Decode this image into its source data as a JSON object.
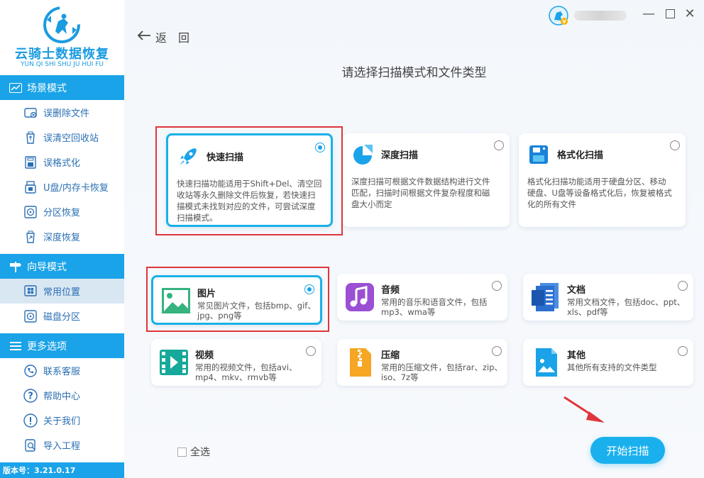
{
  "app": {
    "logo_title": "云骑士数据恢复",
    "logo_subtitle": "YUN QI SHI SHU JU HUI FU",
    "version": "版本号：3.21.0.17"
  },
  "sidebar": {
    "sections": [
      {
        "label": "场景模式",
        "icon": "chart-icon",
        "items": [
          {
            "label": "误删除文件",
            "icon": "disk-delete-icon"
          },
          {
            "label": "误清空回收站",
            "icon": "recycle-bin-icon"
          },
          {
            "label": "误格式化",
            "icon": "format-icon"
          },
          {
            "label": "U盘/内存卡恢复",
            "icon": "usb-icon"
          },
          {
            "label": "分区恢复",
            "icon": "partition-icon"
          },
          {
            "label": "深度恢复",
            "icon": "deep-recover-icon"
          }
        ]
      },
      {
        "label": "向导模式",
        "icon": "signpost-icon",
        "items": [
          {
            "label": "常用位置",
            "icon": "windows-icon",
            "active": true
          },
          {
            "label": "磁盘分区",
            "icon": "disk-icon"
          }
        ]
      },
      {
        "label": "更多选项",
        "icon": "menu-icon",
        "items": [
          {
            "label": "联系客服",
            "icon": "phone-icon"
          },
          {
            "label": "帮助中心",
            "icon": "help-icon"
          },
          {
            "label": "关于我们",
            "icon": "info-icon"
          },
          {
            "label": "导入工程",
            "icon": "import-icon"
          }
        ]
      }
    ]
  },
  "main": {
    "back_label": "返　回",
    "title": "请选择扫描模式和文件类型",
    "scan_modes": [
      {
        "title": "快速扫描",
        "desc": "快速扫描功能适用于Shift+Del、清空回收站等永久删除文件后恢复，若快速扫描模式未找到对应的文件，可尝试深度扫描模式。",
        "icon": "rocket-icon",
        "selected": true
      },
      {
        "title": "深度扫描",
        "desc": "深度扫描可根据文件数据结构进行文件匹配，扫描时间根据文件复杂程度和磁盘大小而定",
        "icon": "deep-scan-icon",
        "selected": false
      },
      {
        "title": "格式化扫描",
        "desc": "格式化扫描功能适用于硬盘分区、移动硬盘、U盘等设备格式化后，恢复被格式化的所有文件",
        "icon": "format-scan-icon",
        "selected": false
      }
    ],
    "file_types": [
      {
        "title": "图片",
        "desc": "常见图片文件，包括bmp、gif、jpg、png等",
        "icon": "image-icon",
        "selected": true
      },
      {
        "title": "音频",
        "desc": "常用的音乐和语音文件，包括mp3、wma等",
        "icon": "music-icon",
        "selected": false
      },
      {
        "title": "文档",
        "desc": "常用文档文件，包括doc、ppt、xls、pdf等",
        "icon": "document-icon",
        "selected": false
      },
      {
        "title": "视频",
        "desc": "常用的视频文件，包括avi、mp4、mkv、rmvb等",
        "icon": "video-icon",
        "selected": false
      },
      {
        "title": "压缩",
        "desc": "常用的压缩文件，包括rar、zip、iso、7z等",
        "icon": "zip-icon",
        "selected": false
      },
      {
        "title": "其他",
        "desc": "其他所有支持的文件类型",
        "icon": "other-file-icon",
        "selected": false
      }
    ],
    "select_all_label": "全选",
    "start_label": "开始扫描"
  },
  "colors": {
    "accent": "#1aa3e8",
    "highlight_box": "#e0353a"
  }
}
